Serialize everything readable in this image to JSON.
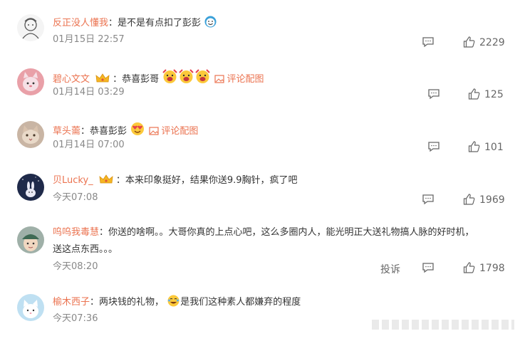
{
  "comments": [
    {
      "username": "反正没人懂我",
      "colon": "：",
      "text": "是不是有点扣了彭彭",
      "time": "01月15日 22:57",
      "likes": "2229",
      "avatar_icon": "line-art-avatar",
      "emoji": "sweat-smile-emoji"
    },
    {
      "username": "碧心文文",
      "colon": "：",
      "text": "恭喜彭哥",
      "link": "评论配图",
      "time": "01月14日 03:29",
      "likes": "125",
      "avatar_icon": "pink-cartoon-avatar",
      "emoji": "celebrate-emoji x3"
    },
    {
      "username": "草头薷",
      "colon": "：",
      "text": "恭喜彭彭",
      "link": "评论配图",
      "time": "01月14日 07:00",
      "likes": "101",
      "avatar_icon": "cat-photo-avatar",
      "emoji": "heart-eyes-emoji"
    },
    {
      "username": "贝Lucky_",
      "colon": "：",
      "text": "本来印象挺好，结果你送9.9胸针，疯了吧",
      "time": "今天07:08",
      "likes": "1969",
      "avatar_icon": "night-bunny-avatar"
    },
    {
      "username": "呜呜我毒慧",
      "colon": "：",
      "text": "你送的啥啊。。大哥你真的上点心吧，这么多圈内人，能光明正大送礼物搞人脉的好时机，",
      "text2": "送这点东西。。。",
      "time": "今天08:20",
      "likes": "1798",
      "report": "投诉",
      "avatar_icon": "green-cap-avatar"
    },
    {
      "username": "榆木西子",
      "colon": "：",
      "text": "两块钱的礼物，",
      "text_after": "是我们这种素人都嫌弃的程度",
      "time": "今天07:36",
      "avatar_icon": "white-cat-avatar",
      "emoji": "laugh-tears-emoji"
    }
  ],
  "colors": {
    "username": "#eb7350",
    "time": "#888888",
    "text": "#333333"
  }
}
